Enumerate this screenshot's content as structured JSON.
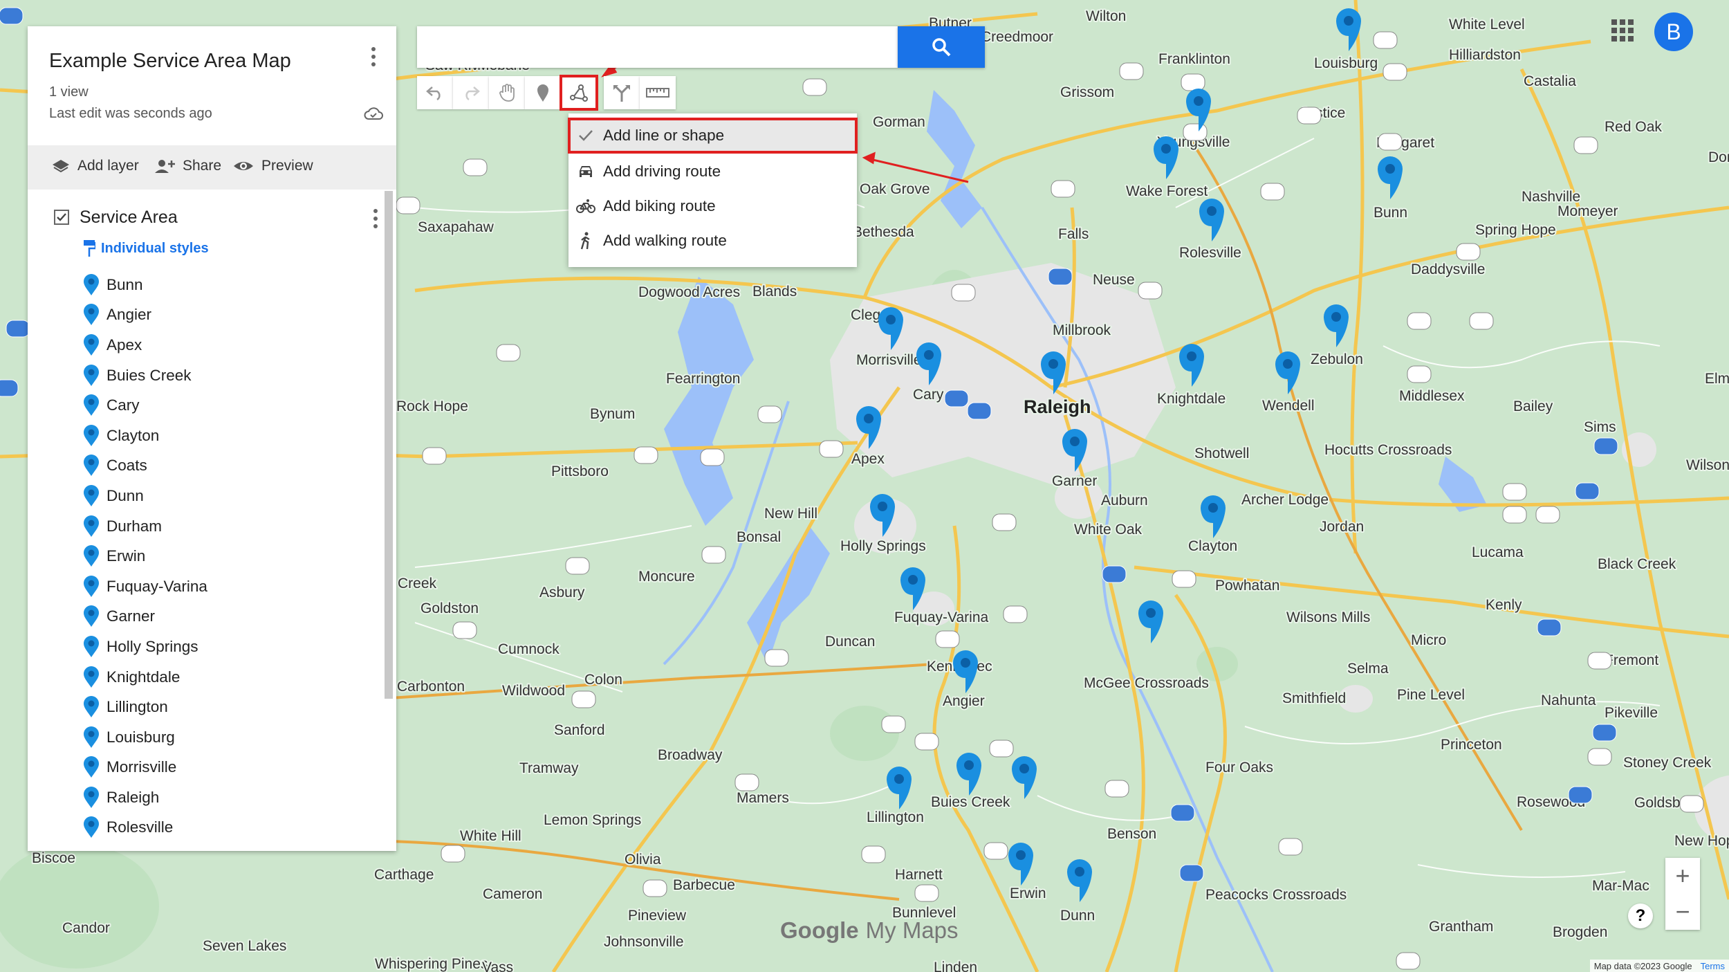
{
  "panel": {
    "title": "Example Service Area Map",
    "views": "1 view",
    "last_edit": "Last edit was seconds ago",
    "actions": {
      "add_layer": "Add layer",
      "share": "Share",
      "preview": "Preview"
    },
    "layer": {
      "name": "Service Area",
      "styles_label": "Individual styles",
      "places": [
        "Bunn",
        "Angier",
        "Apex",
        "Buies Creek",
        "Cary",
        "Clayton",
        "Coats",
        "Dunn",
        "Durham",
        "Erwin",
        "Fuquay-Varina",
        "Garner",
        "Holly Springs",
        "Knightdale",
        "Lillington",
        "Louisburg",
        "Morrisville",
        "Raleigh",
        "Rolesville"
      ]
    }
  },
  "search": {
    "placeholder": ""
  },
  "dropdown": {
    "items": [
      {
        "label": "Add line or shape",
        "icon": "check-icon",
        "selected": true
      },
      {
        "label": "Add driving route",
        "icon": "car-icon"
      },
      {
        "label": "Add biking route",
        "icon": "bike-icon"
      },
      {
        "label": "Add walking route",
        "icon": "walk-icon"
      }
    ]
  },
  "toolbar": {
    "tools": [
      "undo-icon",
      "redo-icon",
      "hand-icon",
      "marker-icon",
      "draw-line-icon",
      "directions-icon",
      "ruler-icon"
    ]
  },
  "account": {
    "initial": "B"
  },
  "colors": {
    "accent": "#1a73e8",
    "highlight": "#e02020",
    "pin": "#1a8fe0"
  },
  "map": {
    "labels": [
      "Wilton",
      "Creedmoor",
      "Butner",
      "Franklinton",
      "Louisburg",
      "White Level",
      "Hilliardston",
      "Castalia",
      "Grissom",
      "Youngsville",
      "Justice",
      "Margaret",
      "Red Oak",
      "Dortches",
      "Gorman",
      "Oak Grove",
      "Wake Forest",
      "Bunn",
      "Nashville",
      "Momeyer",
      "Spring Hope",
      "Bethesda",
      "Falls",
      "Rolesville",
      "Daddysville",
      "Neuse",
      "Saxapahaw",
      "Dogwood Acres",
      "Blands",
      "Clegg",
      "Millbrook",
      "Zebulon",
      "Morrisville",
      "Cary",
      "Raleigh",
      "Knightdale",
      "Wendell",
      "Middlesex",
      "Bailey",
      "Elm City",
      "Rock Hope",
      "Bynum",
      "Pittsboro",
      "Fearrington",
      "Apex",
      "Shotwell",
      "Hocutts Crossroads",
      "Sims",
      "Wilson",
      "Garner",
      "Auburn",
      "Archer Lodge",
      "Fuquay-Varina",
      "New Hill",
      "Bonsal",
      "Holly Springs",
      "White Oak",
      "Clayton",
      "Jordan",
      "Lucama",
      "Black Creek",
      "Moncure",
      "Asbury",
      "Creek",
      "Goldston",
      "Powhatan",
      "Wilsons Mills",
      "Kenly",
      "Duncan",
      "Micro",
      "Cumnock",
      "Kennebec",
      "Angier",
      "McGee Crossroads",
      "Selma",
      "Fremont",
      "Pine Level",
      "Nahunta",
      "Carbonton",
      "Wildwood",
      "Colon",
      "Smithfield",
      "Pikeville",
      "Sanford",
      "Broadway",
      "Princeton",
      "Stoney Creek",
      "Tramway",
      "Four Oaks",
      "Rosewood",
      "Mamers",
      "Lillington",
      "Buies Creek",
      "Lemon Springs",
      "Benson",
      "Goldsboro",
      "White Hill",
      "Olivia",
      "New Hope",
      "Biscoe",
      "Carthage",
      "Harnett",
      "Barbecue",
      "Bunnlevel",
      "Erwin",
      "Dunn",
      "Peacocks Crossroads",
      "Mar-Mac",
      "Cameron",
      "Pineview",
      "Brogden",
      "Grantham",
      "Candor",
      "Seven Lakes",
      "Johnsonville",
      "Whispering Pines",
      "Vass",
      "Linden",
      "Saw River",
      "Mebane"
    ],
    "brand": {
      "google": "Google",
      "mymaps": "My Maps"
    },
    "attribution": "Map data ©2023 Google",
    "terms": "Terms"
  },
  "zoom": {
    "in": "+",
    "out": "−"
  },
  "help": "?"
}
